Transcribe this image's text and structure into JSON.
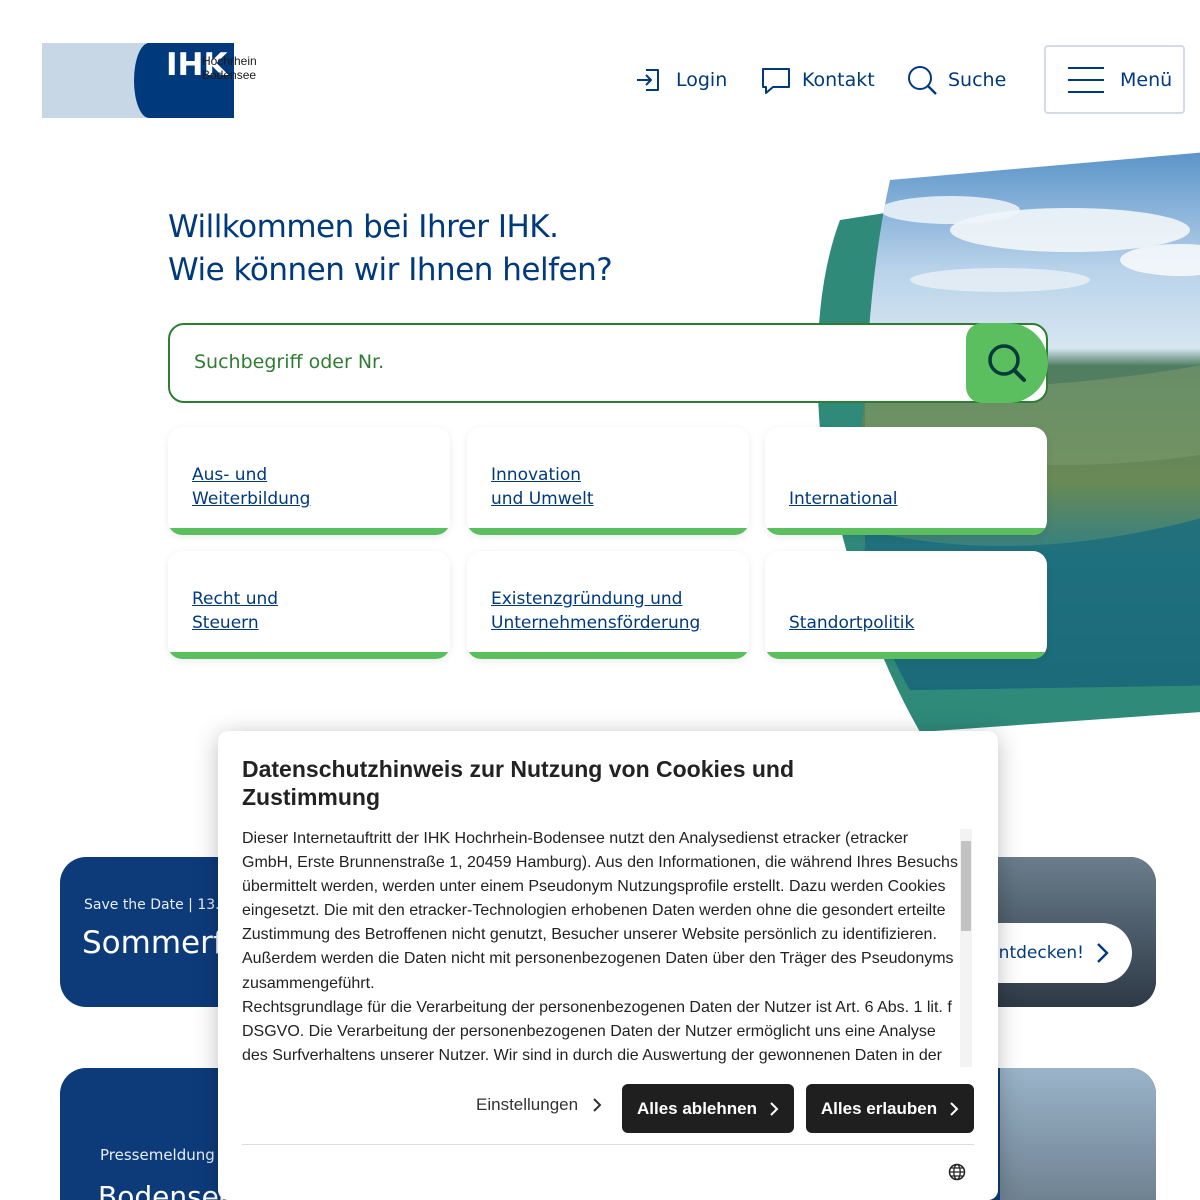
{
  "header": {
    "logo_text": "IHK",
    "logo_place_line1": "Hochrhein",
    "logo_place_line2": "Bodensee",
    "login_label": "Login",
    "contact_label": "Kontakt",
    "search_label": "Suche",
    "menu_label": "Menü"
  },
  "hero": {
    "welcome_line1": "Willkommen bei Ihrer IHK.",
    "welcome_line2": "Wie können wir Ihnen helfen?",
    "search_placeholder": "Suchbegriff oder Nr."
  },
  "tiles": [
    {
      "line1": "Aus- und",
      "line2": "Weiterbildung"
    },
    {
      "line1": "Innovation",
      "line2": "und Umwelt"
    },
    {
      "line1": "",
      "line2": "International"
    },
    {
      "line1": "Recht und",
      "line2": "Steuern"
    },
    {
      "line1": "Existenzgründung und",
      "line2": "Unternehmensförderung"
    },
    {
      "line1": "",
      "line2": "Standortpolitik"
    }
  ],
  "cards": {
    "card1_kicker": "Save the Date | 13. S",
    "card1_title": "Sommerfi",
    "card1_link": "ntdecken!",
    "card2_kicker": "Pressemeldung",
    "card2_title": "Bodenseeforum und"
  },
  "cookie": {
    "title": "Datenschutzhinweis zur Nutzung von Cookies und Zustimmung",
    "body_p1": "Dieser Internetauftritt der IHK Hochrhein-Bodensee nutzt den Analysedienst etracker (etracker GmbH, Erste Brunnenstraße 1, 20459 Hamburg). Aus den Informationen, die während Ihres Besuchs übermittelt werden, werden unter einem Pseudonym Nutzungsprofile erstellt. Dazu werden Cookies eingesetzt. Die mit den etracker-Technologien erhobenen Daten werden ohne die gesondert erteilte Zustimmung des Betroffenen nicht genutzt, Besucher unserer Website persönlich zu identifizieren. Außerdem werden die Daten nicht mit personenbezogenen Daten über den Träger des Pseudonyms zusammengeführt.",
    "body_p2": "Rechtsgrundlage für die Verarbeitung der personenbezogenen Daten der Nutzer ist Art. 6 Abs. 1 lit. f DSGVO. Die Verarbeitung der personenbezogenen Daten der Nutzer ermöglicht uns eine Analyse des Surfverhaltens unserer Nutzer. Wir sind in durch die Auswertung der gewonnenen Daten in der",
    "settings_label": "Einstellungen",
    "reject_label": "Alles ablehnen",
    "accept_label": "Alles erlauben"
  },
  "colors": {
    "brand_blue": "#003a7d",
    "accent_green": "#5cbf5f",
    "teal": "#2f8a7a"
  }
}
